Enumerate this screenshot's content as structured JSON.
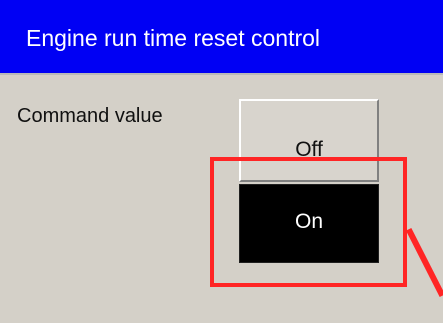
{
  "window": {
    "title": "Engine run time reset control"
  },
  "form": {
    "command_value_label": "Command value"
  },
  "buttons": {
    "off_label": "Off",
    "on_label": "On"
  },
  "state": {
    "selected_value": "On"
  },
  "annotation": {
    "highlight_color": "#ff2525",
    "arrow_color": "#ff2525"
  },
  "colors": {
    "title_bar": "#0000f4",
    "panel_background": "#d4d0c8",
    "off_button_background": "#d8d4cd",
    "on_button_background": "#000000",
    "on_button_text": "#ffffff"
  },
  "icons": {
    "annotation_arrow": "red-arrow-icon"
  }
}
